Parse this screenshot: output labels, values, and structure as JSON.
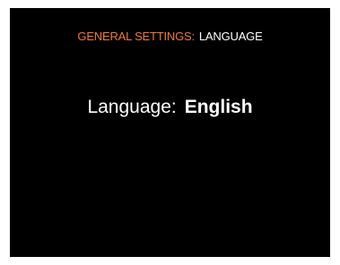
{
  "header": {
    "section": "GENERAL SETTINGS:",
    "page": "LANGUAGE",
    "section_color": "#f07a3a"
  },
  "setting": {
    "label": "Language:",
    "value": "English"
  },
  "colors": {
    "background": "#000000",
    "text": "#ffffff"
  }
}
